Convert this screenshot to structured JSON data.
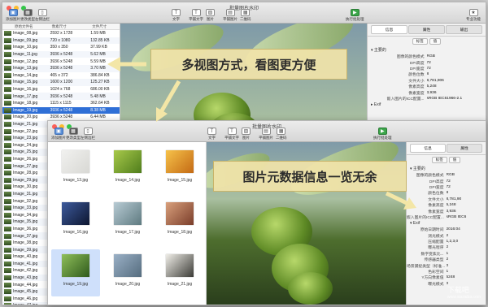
{
  "back_window": {
    "title": "批量图片水印",
    "toolbar_left": [
      {
        "label": "添加图片",
        "icon": "image-add-icon"
      },
      {
        "label": "更改类型",
        "icon": "view-type-icon"
      },
      {
        "label": "左侧边栏",
        "icon": "sidebar-left-icon"
      }
    ],
    "toolbar_center": [
      {
        "label": "文字",
        "icon": "text-icon"
      },
      {
        "label": "平铺文字",
        "icon": "tile-text-icon"
      },
      {
        "label": "图片",
        "icon": "image-icon"
      },
      {
        "label": "平铺图片",
        "icon": "tile-image-icon"
      },
      {
        "label": "二维码",
        "icon": "qrcode-icon"
      }
    ],
    "toolbar_right": [
      {
        "label": "执行批处理",
        "icon": "run-batch-icon"
      },
      {
        "label": "专业功能",
        "icon": "pro-feature-icon"
      }
    ],
    "list_headers": [
      "原始文件名",
      "像素尺寸",
      "文件尺寸"
    ],
    "rows": [
      {
        "name": "Image_08.jpg",
        "dim": "2592 x 1728",
        "size": "1.59 MB"
      },
      {
        "name": "Image_09.jpg",
        "dim": "720 x 1080",
        "size": "132.85 KB"
      },
      {
        "name": "Image_10.jpg",
        "dim": "350 x 350",
        "size": "37.99 KB"
      },
      {
        "name": "Image_11.jpg",
        "dim": "3936 x 5248",
        "size": "5.62 MB"
      },
      {
        "name": "Image_12.jpg",
        "dim": "3936 x 5248",
        "size": "5.59 MB"
      },
      {
        "name": "Image_13.jpg",
        "dim": "3936 x 5248",
        "size": "3.70 MB"
      },
      {
        "name": "Image_14.jpg",
        "dim": "465 x 372",
        "size": "386.84 KB"
      },
      {
        "name": "Image_15.jpg",
        "dim": "1600 x 1200",
        "size": "125.27 KB"
      },
      {
        "name": "Image_16.jpg",
        "dim": "1024 x 768",
        "size": "686.00 KB"
      },
      {
        "name": "Image_17.jpg",
        "dim": "3936 x 5248",
        "size": "5.48 MB"
      },
      {
        "name": "Image_18.jpg",
        "dim": "1115 x 1115",
        "size": "362.64 KB"
      },
      {
        "name": "Image_19.jpg",
        "dim": "3936 x 5248",
        "size": "8.38 MB"
      },
      {
        "name": "Image_20.jpg",
        "dim": "3936 x 5248",
        "size": "6.44 MB"
      },
      {
        "name": "Image_21.jpg",
        "dim": "",
        "size": ""
      },
      {
        "name": "Image_22.jpg",
        "dim": "",
        "size": ""
      },
      {
        "name": "Image_23.jpg",
        "dim": "",
        "size": ""
      },
      {
        "name": "Image_24.jpg",
        "dim": "",
        "size": ""
      },
      {
        "name": "Image_25.jpg",
        "dim": "",
        "size": ""
      },
      {
        "name": "Image_26.jpg",
        "dim": "",
        "size": ""
      },
      {
        "name": "Image_27.jpg",
        "dim": "",
        "size": ""
      },
      {
        "name": "Image_28.jpg",
        "dim": "",
        "size": ""
      },
      {
        "name": "Image_29.jpg",
        "dim": "",
        "size": ""
      },
      {
        "name": "Image_30.jpg",
        "dim": "",
        "size": ""
      },
      {
        "name": "Image_31.jpg",
        "dim": "",
        "size": ""
      },
      {
        "name": "Image_32.jpg",
        "dim": "",
        "size": ""
      },
      {
        "name": "Image_33.jpg",
        "dim": "",
        "size": ""
      },
      {
        "name": "Image_34.jpg",
        "dim": "",
        "size": ""
      },
      {
        "name": "Image_35.jpg",
        "dim": "",
        "size": ""
      },
      {
        "name": "Image_36.jpg",
        "dim": "",
        "size": ""
      },
      {
        "name": "Image_37.jpg",
        "dim": "",
        "size": ""
      },
      {
        "name": "Image_38.jpg",
        "dim": "",
        "size": ""
      },
      {
        "name": "Image_39.jpg",
        "dim": "",
        "size": ""
      },
      {
        "name": "Image_40.jpg",
        "dim": "",
        "size": ""
      },
      {
        "name": "Image_41.jpg",
        "dim": "",
        "size": ""
      },
      {
        "name": "Image_42.jpg",
        "dim": "",
        "size": ""
      },
      {
        "name": "Image_43.jpg",
        "dim": "",
        "size": ""
      },
      {
        "name": "Image_44.jpg",
        "dim": "",
        "size": ""
      },
      {
        "name": "Image_45.jpg",
        "dim": "",
        "size": ""
      },
      {
        "name": "Image_46.jpg",
        "dim": "",
        "size": ""
      },
      {
        "name": "Image_47.jpg",
        "dim": "",
        "size": ""
      }
    ],
    "selected_row": 11,
    "inspector_tabs": [
      "信息",
      "属性",
      "输出"
    ],
    "inspector_subtabs": [
      "标签",
      "值"
    ],
    "section_main": "▾ 主要的",
    "section_exif": "▸ Exif",
    "info": [
      {
        "k": "图像的颜色模式",
        "v": "RGB"
      },
      {
        "k": "DPI高度",
        "v": "72"
      },
      {
        "k": "DPI宽度",
        "v": "72"
      },
      {
        "k": "颜色位数",
        "v": "8"
      },
      {
        "k": "文件大小",
        "v": "8,781,906"
      },
      {
        "k": "像素高度",
        "v": "5,248"
      },
      {
        "k": "像素宽度",
        "v": "3,936"
      },
      {
        "k": "嵌入图片的ICC配置...",
        "v": "sRGB IEC61966-2.1"
      }
    ]
  },
  "front_window": {
    "title": "批量图片水印",
    "toolbar_left": [
      {
        "label": "添加图片",
        "icon": "image-add-icon"
      },
      {
        "label": "更改类型",
        "icon": "view-type-icon"
      },
      {
        "label": "左侧边栏",
        "icon": "sidebar-left-icon"
      }
    ],
    "toolbar_center": [
      {
        "label": "文字",
        "icon": "text-icon"
      },
      {
        "label": "平铺文字",
        "icon": "tile-text-icon"
      },
      {
        "label": "图片",
        "icon": "image-icon"
      },
      {
        "label": "平铺图片",
        "icon": "tile-image-icon"
      },
      {
        "label": "二维码",
        "icon": "qrcode-icon"
      }
    ],
    "toolbar_right": [
      {
        "label": "执行批处理",
        "icon": "run-batch-icon"
      }
    ],
    "grid": [
      {
        "name": "Image_13.jpg",
        "c1": "#f1f1ef",
        "c2": "#d8d8d4"
      },
      {
        "name": "Image_14.jpg",
        "c1": "#a8c94a",
        "c2": "#4f7d1c"
      },
      {
        "name": "Image_15.jpg",
        "c1": "#f6c24a",
        "c2": "#c46a14"
      },
      {
        "name": "Image_16.jpg",
        "c1": "#3d5a9c",
        "c2": "#0d1630"
      },
      {
        "name": "Image_17.jpg",
        "c1": "#b8cbd4",
        "c2": "#5e7a80"
      },
      {
        "name": "Image_18.jpg",
        "c1": "#d9a07c",
        "c2": "#7a3d2a"
      },
      {
        "name": "Image_19.jpg",
        "c1": "#8fbf5a",
        "c2": "#2f5a1c"
      },
      {
        "name": "Image_20.jpg",
        "c1": "#9ab0c6",
        "c2": "#556c7e"
      },
      {
        "name": "Image_21.jpg",
        "c1": "#f0eee8",
        "c2": "#3b3b36"
      }
    ],
    "selected_cell": 6,
    "inspector_tabs": [
      "信息",
      "属性"
    ],
    "inspector_subtabs": [
      "标签",
      "值"
    ],
    "section_main": "▾ 主要的",
    "section_exif": "▾ Exif",
    "info": [
      {
        "k": "图像的颜色模式",
        "v": "RGB"
      },
      {
        "k": "DPI高度",
        "v": "72"
      },
      {
        "k": "DPI宽度",
        "v": "72"
      },
      {
        "k": "颜色位数",
        "v": "8"
      },
      {
        "k": "文件大小",
        "v": "8,781,90"
      },
      {
        "k": "像素高度",
        "v": "5,248"
      },
      {
        "k": "像素宽度",
        "v": "3,936"
      },
      {
        "k": "嵌入图片的ICC配置...",
        "v": "sRGB IEC6"
      }
    ],
    "exif": [
      {
        "k": "原始日期时间",
        "v": "2016:04"
      },
      {
        "k": "测光模式",
        "v": "2"
      },
      {
        "k": "压缩配置",
        "v": "1,2,3,0"
      },
      {
        "k": "曝光程序",
        "v": "2"
      },
      {
        "k": "数字变焦比...",
        "v": "1"
      },
      {
        "k": "传感器类型",
        "v": "2"
      },
      {
        "k": "场景捕捉类型（标准...",
        "v": "0"
      },
      {
        "k": "色彩空间",
        "v": "1"
      },
      {
        "k": "Y方向像素值",
        "v": "5248"
      },
      {
        "k": "曝光模式",
        "v": "0"
      }
    ]
  },
  "callouts": {
    "multi_view": "多视图方式，看图更方便",
    "metadata": "图片元数据信息一览无余"
  },
  "watermark": {
    "title": "下载吧",
    "url": "www.xiazaiba.com"
  },
  "colors": {
    "selection": "#2f6fd6",
    "callout_bg": "#f0e3a9",
    "light_red": "#fc5f57",
    "light_yellow": "#fdbc2e",
    "light_green": "#33c748"
  }
}
